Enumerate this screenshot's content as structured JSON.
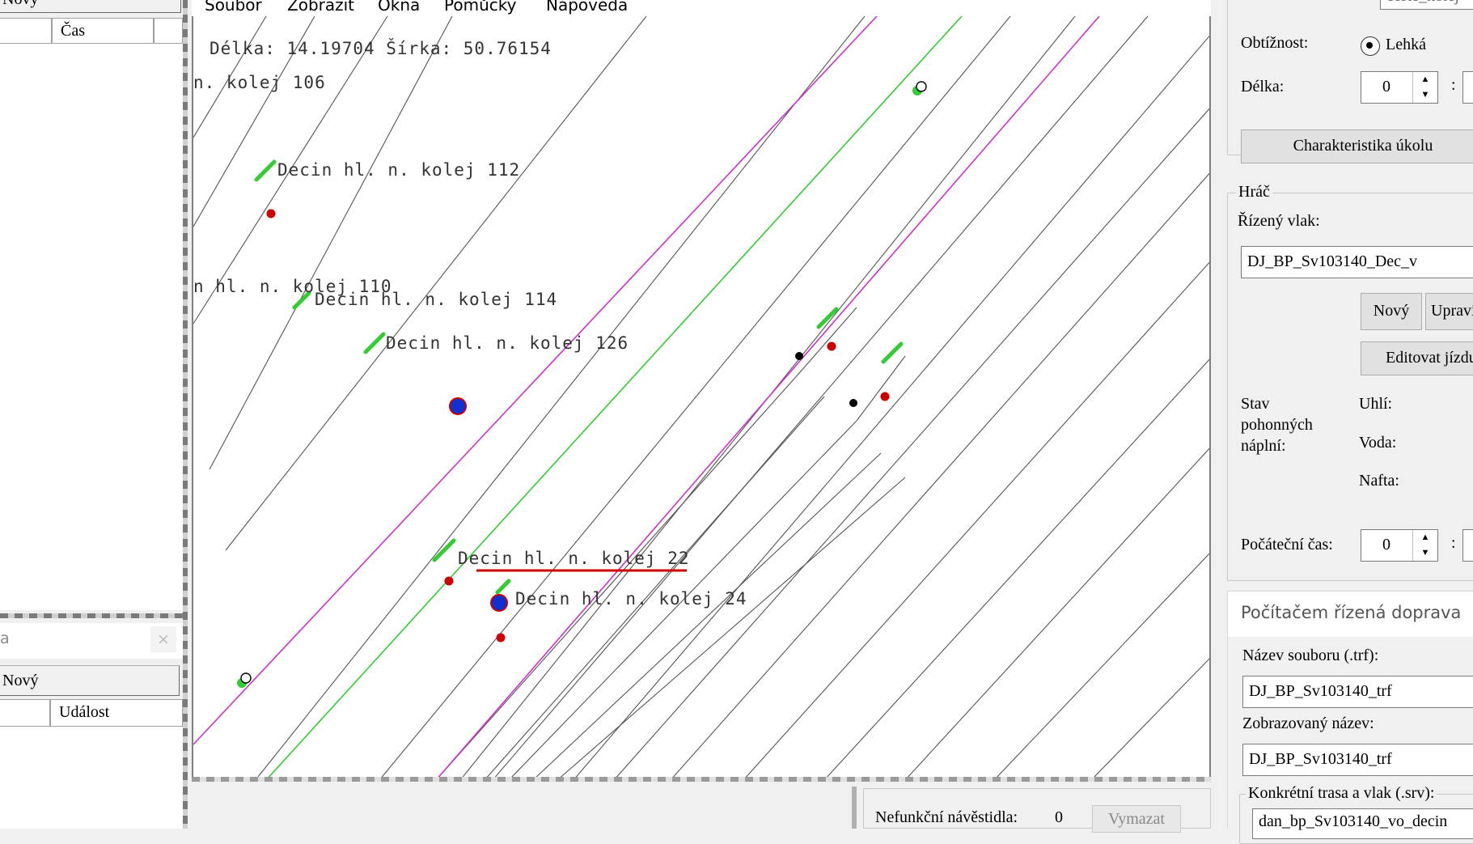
{
  "left": {
    "top_button": "Nový",
    "top_col2": "Čas",
    "bottom_title_fragment": "a",
    "bottom_close": "×",
    "bottom_button": "Nový",
    "bottom_col2": "Událost"
  },
  "menu": {
    "items": [
      "Soubor",
      "Zobrazit",
      "Okna",
      "Pomůcky",
      "Nápověda"
    ]
  },
  "map": {
    "coords": "Délka: 14.19704 Šírka: 50.76154",
    "labels": [
      "n. kolej 106",
      "Decin hl. n. kolej 112",
      "n hl. n. kolej 110",
      "Decin hl. n. kolej 114",
      "Decin hl. n. kolej 126",
      "Decin hl. n. kolej 22",
      "Decin hl. n. kolej 24"
    ]
  },
  "status": {
    "signals_label": "Nefunkční návěstidla:",
    "signals_count": "0",
    "clear_button": "Vymazat"
  },
  "right": {
    "top_input": "ceste_kolej",
    "difficulty_label": "Obtížnost:",
    "difficulty_value": "Lehká",
    "length_label": "Délka:",
    "length_value": "0",
    "colon": ":",
    "characteristics_button": "Charakteristika úkolu",
    "player_legend": "Hráč",
    "controlled_train_label": "Řízený vlak:",
    "controlled_train_value": "DJ_BP_Sv103140_Dec_v",
    "new_button": "Nový",
    "edit_button": "Upravit",
    "edit_ride_button": "Editovat jízdu",
    "fuel_label_1": "Stav",
    "fuel_label_2": "pohonných",
    "fuel_label_3": "náplní:",
    "coal_label": "Uhlí:",
    "water_label": "Voda:",
    "diesel_label": "Nafta:",
    "start_time_label": "Počáteční čas:",
    "start_time_value": "0",
    "ai_title": "Počítačem řízená doprava",
    "filename_label": "Název souboru (.trf):",
    "filename_value": "DJ_BP_Sv103140_trf",
    "display_name_label": "Zobrazovaný název:",
    "display_name_value": "DJ_BP_Sv103140_trf",
    "route_legend": "Konkrétní trasa a vlak (.srv):",
    "route_value": "dan_bp_Sv103140_vo_decin"
  },
  "colors": {
    "magenta": "#cc33cc",
    "green": "#33cc33",
    "red": "#cc0000",
    "blue": "#1030d0"
  }
}
